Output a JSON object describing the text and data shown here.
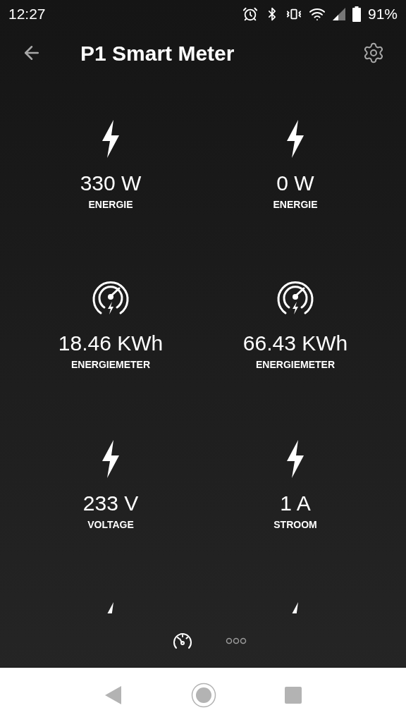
{
  "status_bar": {
    "time": "12:27",
    "battery": "91%"
  },
  "header": {
    "title": "P1 Smart Meter"
  },
  "tiles": [
    {
      "kind": "bolt",
      "value": "330 W",
      "label": "ENERGIE"
    },
    {
      "kind": "bolt",
      "value": "0 W",
      "label": "ENERGIE"
    },
    {
      "kind": "meter",
      "value": "18.46 KWh",
      "label": "ENERGIEMETER"
    },
    {
      "kind": "meter",
      "value": "66.43 KWh",
      "label": "ENERGIEMETER"
    },
    {
      "kind": "bolt",
      "value": "233 V",
      "label": "VOLTAGE"
    },
    {
      "kind": "bolt",
      "value": "1 A",
      "label": "STROOM"
    },
    {
      "kind": "bolt"
    },
    {
      "kind": "bolt"
    }
  ],
  "bottom_tabs": [
    {
      "kind": "gauge",
      "selected": true
    },
    {
      "kind": "dots",
      "selected": false
    }
  ]
}
